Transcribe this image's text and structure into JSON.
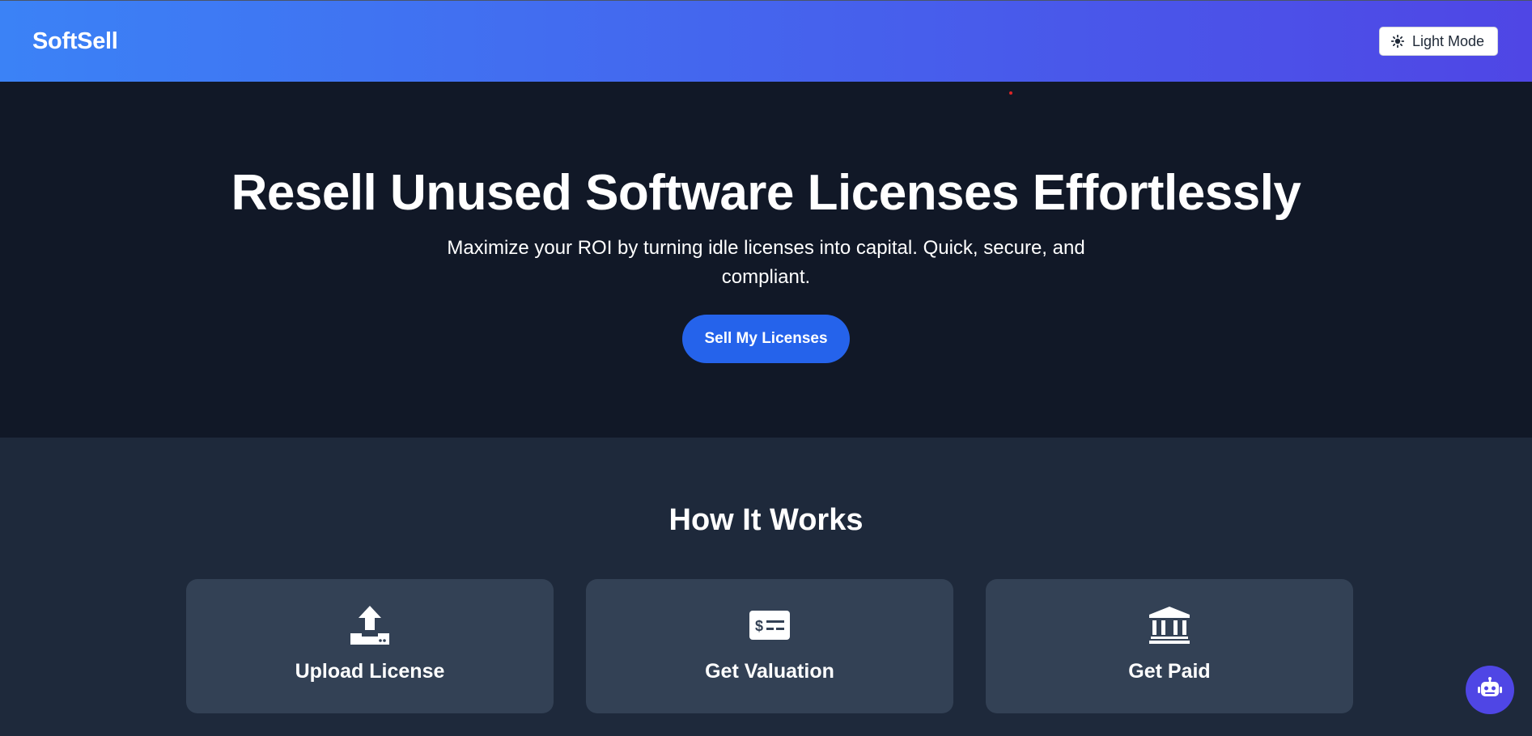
{
  "header": {
    "logo": "SoftSell",
    "mode_button": {
      "label": "Light Mode",
      "icon": "sun-icon"
    }
  },
  "hero": {
    "title": "Resell Unused Software Licenses Effortlessly",
    "subtitle": "Maximize your ROI by turning idle licenses into capital. Quick, secure, and compliant.",
    "cta_label": "Sell My Licenses"
  },
  "how_it_works": {
    "title": "How It Works",
    "steps": [
      {
        "label": "Upload License",
        "icon": "upload-icon"
      },
      {
        "label": "Get Valuation",
        "icon": "money-check-icon"
      },
      {
        "label": "Get Paid",
        "icon": "bank-icon"
      }
    ]
  },
  "chat_button": {
    "icon": "robot-icon"
  },
  "colors": {
    "header_gradient_start": "#3b82f6",
    "header_gradient_end": "#4f46e5",
    "hero_bg": "#111827",
    "section_bg": "#1e293b",
    "card_bg": "#334155",
    "cta_bg": "#2563eb",
    "chat_bg": "#4f46e5"
  }
}
